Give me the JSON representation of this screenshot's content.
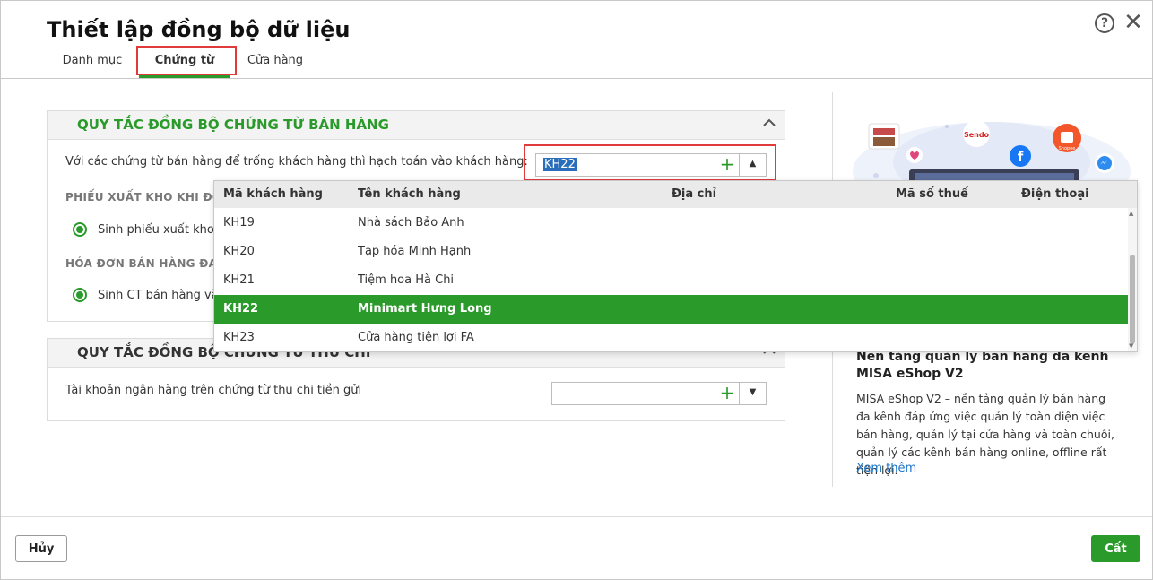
{
  "dialog": {
    "title": "Thiết lập đồng bộ dữ liệu",
    "help_label": "?",
    "close_label": "✕"
  },
  "tabs": [
    {
      "label": "Danh mục"
    },
    {
      "label": "Chứng từ"
    },
    {
      "label": "Cửa hàng"
    }
  ],
  "section_sales": {
    "title": "QUY TẮC ĐỒNG BỘ CHỨNG TỪ BÁN HÀNG",
    "customer_label": "Với các chứng từ bán hàng để trống khách hàng thì hạch toán vào khách hàng:",
    "customer_value": "KH22",
    "warehouse_heading": "PHIẾU XUẤT KHO KHI ĐỒN",
    "warehouse_option": "Sinh phiếu xuất kho k",
    "invoice_heading": "HÓA ĐƠN BÁN HÀNG ĐAN",
    "invoice_option": "Sinh CT bán hàng và"
  },
  "section_cash": {
    "title": "QUY TẮC ĐỒNG BỘ CHỨNG TỪ THU CHI",
    "bank_label": "Tài khoản ngân hàng trên chứng từ thu chi tiền gửi",
    "bank_value": ""
  },
  "dropdown": {
    "columns": [
      "Mã khách hàng",
      "Tên khách hàng",
      "Địa chỉ",
      "Mã số thuế",
      "Điện thoại"
    ],
    "rows": [
      {
        "code": "KH19",
        "name": "Nhà sách Bảo Anh",
        "selected": false
      },
      {
        "code": "KH20",
        "name": "Tạp hóa Minh Hạnh",
        "selected": false
      },
      {
        "code": "KH21",
        "name": "Tiệm hoa Hà Chi",
        "selected": false
      },
      {
        "code": "KH22",
        "name": "Minimart Hưng Long",
        "selected": true
      },
      {
        "code": "KH23",
        "name": "Cửa hàng tiện lợi FA",
        "selected": false
      }
    ]
  },
  "promo": {
    "title": "Nền tảng quản lý bán hàng đa kênh MISA eShop V2",
    "description": "MISA eShop V2 – nền tảng quản lý bán hàng đa kênh đáp ứng việc quản lý toàn diện việc bán hàng, quản lý tại cửa hàng và toàn chuỗi, quản lý các kênh bán hàng online, offline rất tiện lợi.",
    "link": "Xem thêm",
    "sendo_label": "Sendo",
    "shopee_label": "Shopee"
  },
  "footer": {
    "cancel_label": "Hủy",
    "save_label": "Cất"
  },
  "colors": {
    "accent": "#2a9a2a",
    "highlight_red": "#e03b3b",
    "link": "#1a73c8"
  }
}
